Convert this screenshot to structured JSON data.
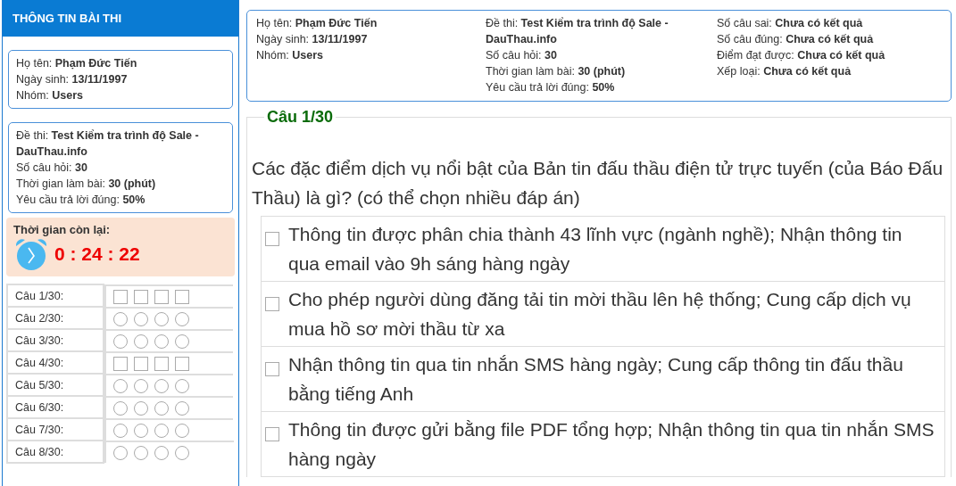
{
  "sidebar": {
    "title": "THÔNG TIN BÀI THI",
    "candidate": [
      {
        "label": "Họ tên:",
        "value": "Phạm Đức Tiến"
      },
      {
        "label": "Ngày sinh:",
        "value": "13/11/1997"
      },
      {
        "label": "Nhóm:",
        "value": "Users"
      }
    ],
    "exam": [
      {
        "label": "Đề thi:",
        "value": "Test Kiểm tra trình độ Sale - DauThau.info"
      },
      {
        "label": "Số câu hỏi:",
        "value": "30"
      },
      {
        "label": "Thời gian làm bài:",
        "value": "30 (phút)"
      },
      {
        "label": "Yêu cầu trả lời đúng:",
        "value": "50%"
      }
    ],
    "timer": {
      "label": "Thời gian còn lại:",
      "value": "0 : 24 : 22"
    },
    "questions": [
      {
        "label": "Câu 1/30:",
        "kind": "checkbox",
        "options": [
          false,
          false,
          false,
          false
        ]
      },
      {
        "label": "Câu 2/30:",
        "kind": "radio",
        "options": [
          false,
          false,
          false,
          false
        ]
      },
      {
        "label": "Câu 3/30:",
        "kind": "radio",
        "options": [
          false,
          false,
          false,
          false
        ]
      },
      {
        "label": "Câu 4/30:",
        "kind": "checkbox",
        "options": [
          false,
          false,
          false,
          false
        ]
      },
      {
        "label": "Câu 5/30:",
        "kind": "radio",
        "options": [
          false,
          false,
          false,
          false
        ]
      },
      {
        "label": "Câu 6/30:",
        "kind": "radio",
        "options": [
          false,
          false,
          false,
          false
        ]
      },
      {
        "label": "Câu 7/30:",
        "kind": "radio",
        "options": [
          false,
          false,
          false,
          false
        ]
      },
      {
        "label": "Câu 8/30:",
        "kind": "radio",
        "options": [
          false,
          false,
          false,
          false
        ]
      }
    ]
  },
  "info": {
    "columns": [
      [
        {
          "label": "Họ tên:",
          "value": "Phạm Đức Tiến"
        },
        {
          "label": "Ngày sinh:",
          "value": "13/11/1997"
        },
        {
          "label": "Nhóm:",
          "value": "Users"
        }
      ],
      [
        {
          "label": "Đề thi:",
          "value": "Test Kiểm tra trình độ Sale - DauThau.info"
        },
        {
          "label": "Số câu hỏi:",
          "value": "30"
        },
        {
          "label": "Thời gian làm bài:",
          "value": "30 (phút)"
        },
        {
          "label": "Yêu cầu trả lời đúng:",
          "value": "50%"
        }
      ],
      [
        {
          "label": "Số câu sai:",
          "value": "Chưa có kết quả"
        },
        {
          "label": "Số câu đúng:",
          "value": "Chưa có kết quả"
        },
        {
          "label": "Điểm đạt được:",
          "value": "Chưa có kết quả"
        },
        {
          "label": "Xếp loại:",
          "value": "Chưa có kết quả"
        }
      ]
    ]
  },
  "question": {
    "title": "Câu 1/30",
    "text": "Các đặc điểm dịch vụ nổi bật của Bản tin đấu thầu điện tử trực tuyến (của Báo Đấu Thầu) là gì? (có thể chọn nhiều đáp án)",
    "answers": [
      {
        "text": "Thông tin được phân chia thành 43 lĩnh vực (ngành nghề); Nhận thông tin qua email vào 9h sáng hàng ngày",
        "checked": false
      },
      {
        "text": "Cho phép người dùng đăng tải tin mời thầu lên hệ thống; Cung cấp dịch vụ mua hồ sơ mời thầu từ xa",
        "checked": false
      },
      {
        "text": "Nhận thông tin qua tin nhắn SMS hàng ngày; Cung cấp thông tin đấu thầu bằng tiếng Anh",
        "checked": false
      },
      {
        "text": "Thông tin được gửi bằng file PDF tổng hợp; Nhận thông tin qua tin nhắn SMS hàng ngày",
        "checked": false
      }
    ]
  }
}
